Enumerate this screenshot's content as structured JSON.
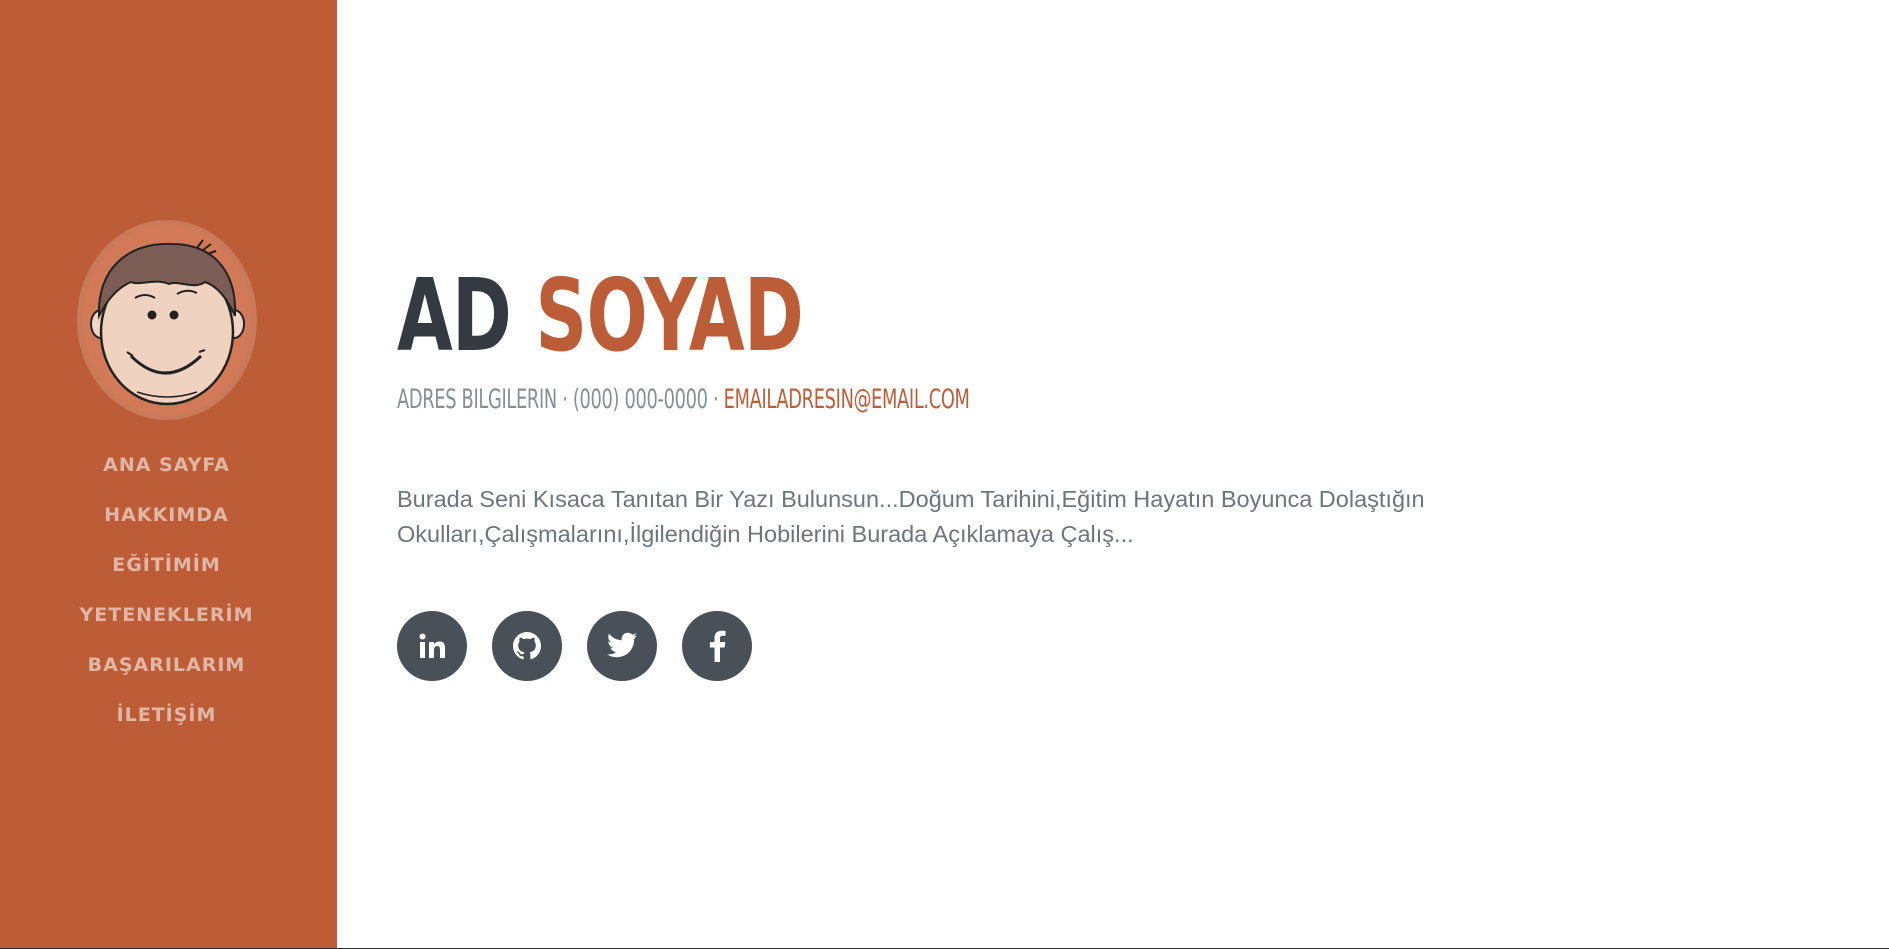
{
  "sidebar": {
    "nav": [
      {
        "label": "ANA SAYFA"
      },
      {
        "label": "HAKKIMDA"
      },
      {
        "label": "EĞİTİMİM"
      },
      {
        "label": "YETENEKLERİM"
      },
      {
        "label": "BAŞARILARIM"
      },
      {
        "label": "İLETİŞİM"
      }
    ]
  },
  "main": {
    "first_name": "AD",
    "last_name": "SOYAD",
    "contact": {
      "address": "ADRES BILGILERIN",
      "separator": " · ",
      "phone": "(000) 000-0000",
      "email": "EMAILADRESIN@EMAIL.COM"
    },
    "bio": "Burada Seni Kısaca Tanıtan Bir Yazı Bulunsun...Doğum Tarihini,Eğitim Hayatın Boyunca Dolaştığın Okulları,Çalışmalarını,İlgilendiğin Hobilerini Burada Açıklamaya Çalış...",
    "social": [
      {
        "icon": "linkedin-icon"
      },
      {
        "icon": "github-icon"
      },
      {
        "icon": "twitter-icon"
      },
      {
        "icon": "facebook-icon"
      }
    ]
  },
  "colors": {
    "sidebar_bg": "#bd5d38",
    "accent": "#bd5d38",
    "heading": "#343a40",
    "text_muted": "#868e96",
    "social_bg": "#495057"
  }
}
